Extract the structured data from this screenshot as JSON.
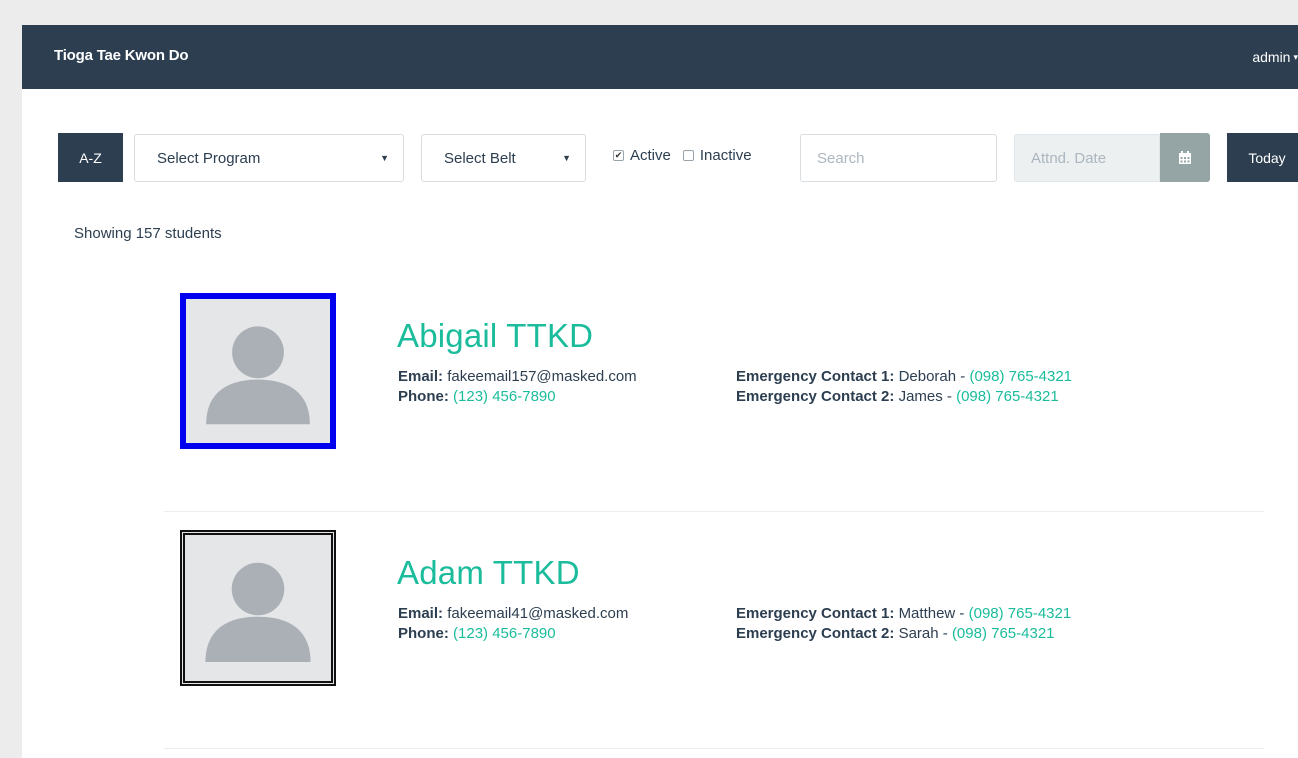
{
  "navbar": {
    "brand": "Tioga Tae Kwon Do",
    "user": "admin"
  },
  "toolbar": {
    "az_label": "A-Z",
    "program_select": "Select Program",
    "belt_select": "Select Belt",
    "active_label": "Active",
    "active_checked": true,
    "inactive_label": "Inactive",
    "inactive_checked": false,
    "search_placeholder": "Search",
    "date_placeholder": "Attnd. Date",
    "today_label": "Today"
  },
  "count_text": "Showing 157 students",
  "labels": {
    "email": "Email:",
    "phone": "Phone:",
    "ec1": "Emergency Contact 1:",
    "ec2": "Emergency Contact 2:"
  },
  "students": [
    {
      "name": "Abigail TTKD",
      "email": "fakeemail157@masked.com",
      "phone": "(123) 456-7890",
      "ec1_name": "Deborah",
      "ec1_phone": "(098) 765-4321",
      "ec2_name": "James",
      "ec2_phone": "(098) 765-4321"
    },
    {
      "name": "Adam TTKD",
      "email": "fakeemail41@masked.com",
      "phone": "(123) 456-7890",
      "ec1_name": "Matthew",
      "ec1_phone": "(098) 765-4321",
      "ec2_name": "Sarah",
      "ec2_phone": "(098) 765-4321"
    }
  ],
  "colors": {
    "navbar": "#2c3e50",
    "accent": "#1abc9c",
    "selected_border": "#0000ee"
  },
  "icons": {
    "calendar": "calendar-icon",
    "avatar": "person-placeholder-icon"
  }
}
